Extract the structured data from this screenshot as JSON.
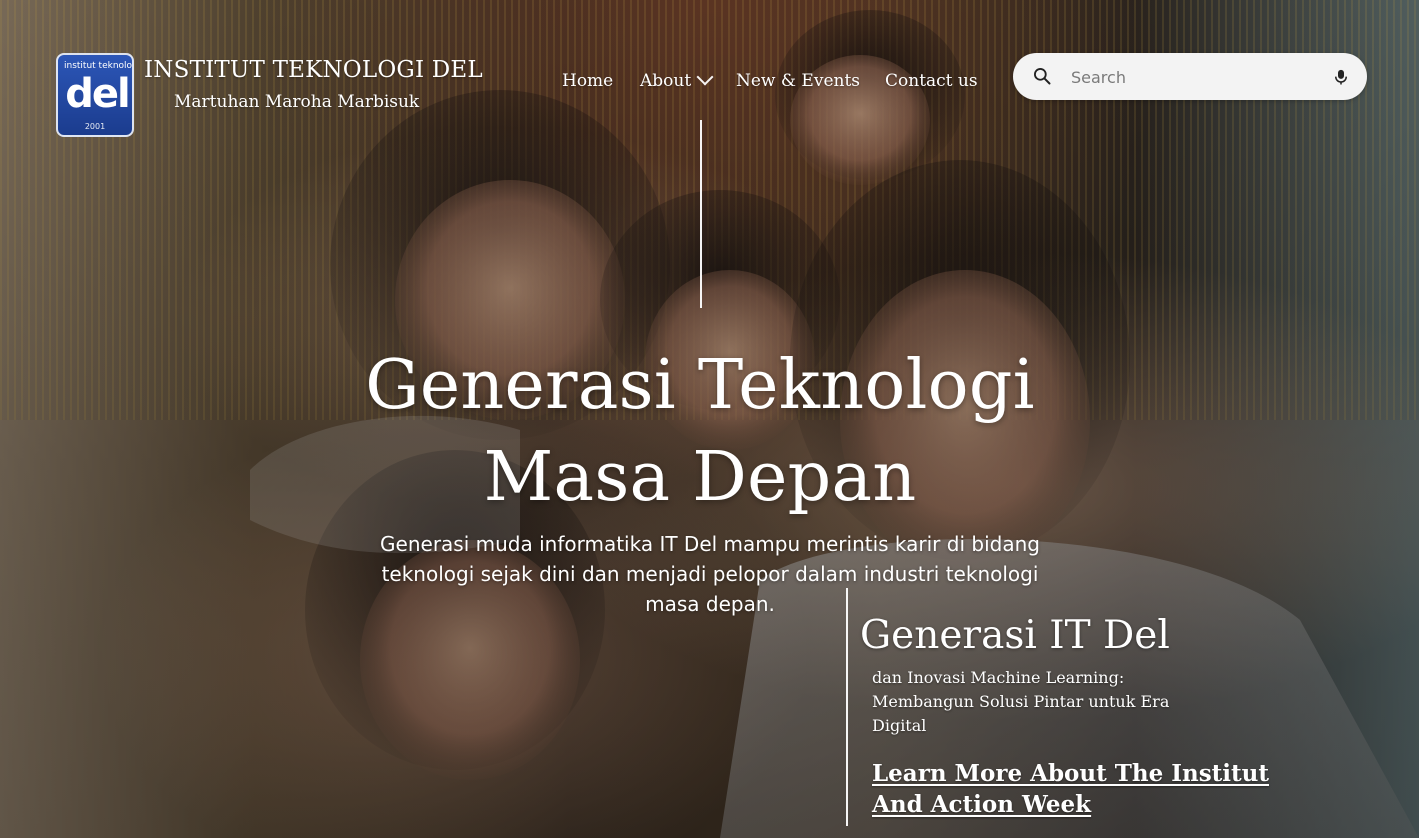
{
  "header": {
    "logo": {
      "top_text": "institut teknologi",
      "main_text": "del",
      "year_text": "2001"
    },
    "title": "INSTITUT TEKNOLOGI DEL",
    "subtitle": "Martuhan Maroha Marbisuk"
  },
  "nav": {
    "items": [
      {
        "label": "Home"
      },
      {
        "label": "About",
        "icon": "chevron-down-icon"
      },
      {
        "label": "New & Events"
      },
      {
        "label": "Contact us"
      }
    ]
  },
  "search": {
    "placeholder": "Search",
    "icons": {
      "left": "search-icon",
      "right": "mic-icon"
    }
  },
  "hero": {
    "heading": "Generasi Teknologi Masa Depan",
    "description": "Generasi muda informatika IT Del mampu merintis karir di bidang teknologi sejak dini dan menjadi pelopor dalam industri teknologi masa depan."
  },
  "feature": {
    "title": "Generasi IT Del",
    "text": "dan Inovasi Machine Learning: Membangun Solusi Pintar untuk Era Digital",
    "link_label": "Learn More About The Institut And Action Week"
  },
  "colors": {
    "text": "#ffffff",
    "search_bg": "#f3f3f3",
    "logo_blue": "#2c56b7"
  }
}
